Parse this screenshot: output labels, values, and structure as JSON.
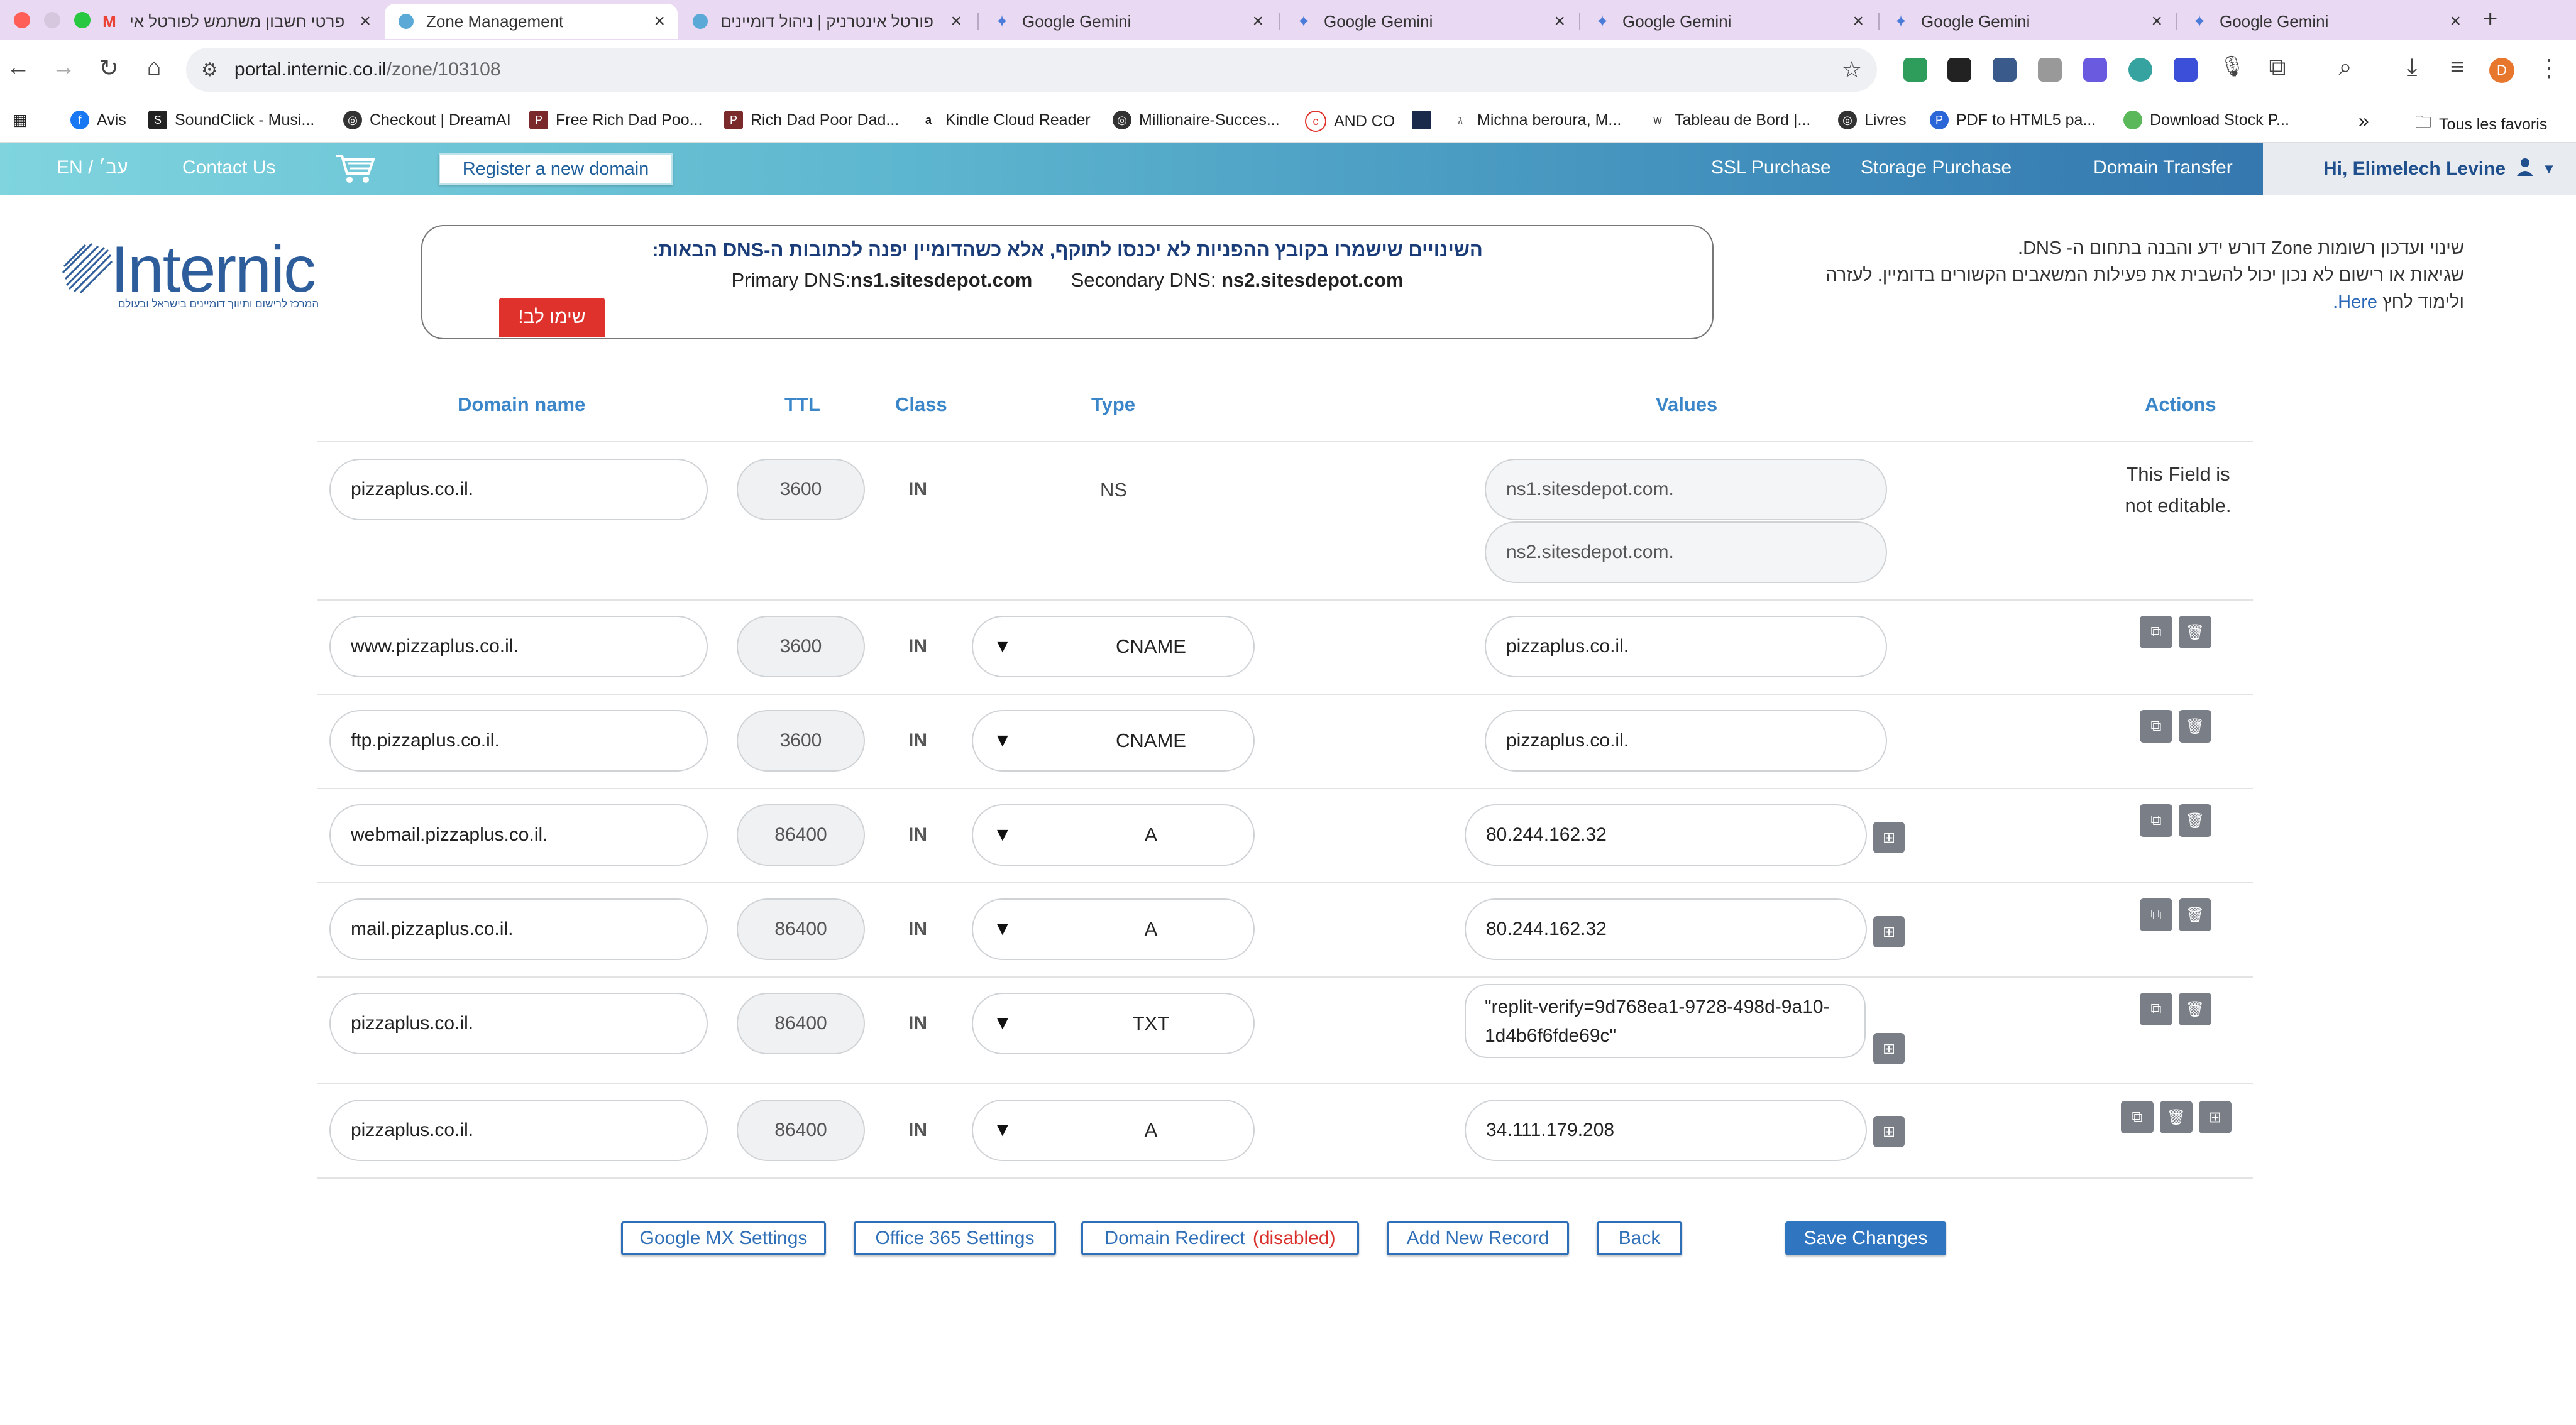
{
  "browser": {
    "tabs": [
      {
        "title": "פרטי חשבון משתמש לפורטל אי",
        "icon": "gmail-icon",
        "active": false
      },
      {
        "title": "Zone Management",
        "icon": "site-icon",
        "active": true
      },
      {
        "title": "פורטל אינטרניק | ניהול דומיינים",
        "icon": "site-icon",
        "active": false
      },
      {
        "title": "Google Gemini",
        "icon": "gemini-icon",
        "active": false
      },
      {
        "title": "Google Gemini",
        "icon": "gemini-icon",
        "active": false
      },
      {
        "title": "Google Gemini",
        "icon": "gemini-icon",
        "active": false
      },
      {
        "title": "Google Gemini",
        "icon": "gemini-icon",
        "active": false
      },
      {
        "title": "Google Gemini",
        "icon": "gemini-icon",
        "active": false
      }
    ],
    "url_host": "portal.internic.co.il",
    "url_path": "/zone/103108",
    "bookmarks": [
      "Avis",
      "SoundClick - Musi...",
      "Checkout | DreamAI",
      "Free Rich Dad Poo...",
      "Rich Dad Poor Dad...",
      "Kindle Cloud Reader",
      "Millionaire-Succes...",
      "AND CO",
      "Michna beroura, M...",
      "Tableau de Bord |...",
      "Livres",
      "PDF to HTML5 pa...",
      "Download Stock P..."
    ],
    "bookmarks_more": "»",
    "bookmarks_folder": "Tous les favoris",
    "profile_letter": "D"
  },
  "nav": {
    "lang": "EN / עב׳",
    "contact": "Contact Us",
    "register": "Register a new domain",
    "ssl": "SSL Purchase",
    "storage": "Storage Purchase",
    "transfer": "Domain Transfer",
    "user_greeting": "Hi, Elimelech Levine"
  },
  "logo": {
    "name": "Internic",
    "tagline": "המרכז לרישום ותיווך דומיינים בישראל ובעולם"
  },
  "notice": {
    "hebrew": "השינויים שישמרו בקובץ ההפניות לא יכנסו לתוקף, אלא כשהדומיין יפנה לכתובות ה-DNS הבאות:",
    "primary_label": "Primary DNS:",
    "primary_value": "ns1.sitesdepot.com",
    "secondary_label": "Secondary DNS:",
    "secondary_value": "ns2.sitesdepot.com",
    "attention": "שימו לב!"
  },
  "help": {
    "line1": "שינוי ועדכון רשומות Zone דורש ידע והבנה בתחום ה- DNS.",
    "line2": "שגיאות או רישום לא נכון יכול להשבית את פעילות המשאבים הקשורים בדומיין. לעזרה",
    "line3_prefix": "ולימוד לחץ ",
    "here": "Here."
  },
  "table": {
    "headers": {
      "domain": "Domain name",
      "ttl": "TTL",
      "class": "Class",
      "type": "Type",
      "values": "Values",
      "actions": "Actions"
    },
    "ns_row": {
      "domain": "pizzaplus.co.il.",
      "ttl": "3600",
      "class": "IN",
      "type": "NS",
      "values": [
        "ns1.sitesdepot.com.",
        "ns2.sitesdepot.com."
      ],
      "not_editable_1": "This Field is",
      "not_editable_2": "not editable."
    },
    "rows": [
      {
        "domain": "www.pizzaplus.co.il.",
        "ttl": "3600",
        "class": "IN",
        "type": "CNAME",
        "value": "pizzaplus.co.il."
      },
      {
        "domain": "ftp.pizzaplus.co.il.",
        "ttl": "3600",
        "class": "IN",
        "type": "CNAME",
        "value": "pizzaplus.co.il."
      },
      {
        "domain": "webmail.pizzaplus.co.il.",
        "ttl": "86400",
        "class": "IN",
        "type": "A",
        "value": "80.244.162.32"
      },
      {
        "domain": "mail.pizzaplus.co.il.",
        "ttl": "86400",
        "class": "IN",
        "type": "A",
        "value": "80.244.162.32"
      },
      {
        "domain": "pizzaplus.co.il.",
        "ttl": "86400",
        "class": "IN",
        "type": "TXT",
        "value": "\"replit-verify=9d768ea1-9728-498d-9a10-1d4b6f6fde69c\""
      },
      {
        "domain": "pizzaplus.co.il.",
        "ttl": "86400",
        "class": "IN",
        "type": "A",
        "value": "34.111.179.208"
      }
    ]
  },
  "buttons": {
    "google_mx": "Google MX Settings",
    "office365": "Office 365 Settings",
    "redirect": "Domain Redirect",
    "redirect_state": "(disabled)",
    "add_record": "Add New Record",
    "back": "Back",
    "save": "Save Changes"
  }
}
